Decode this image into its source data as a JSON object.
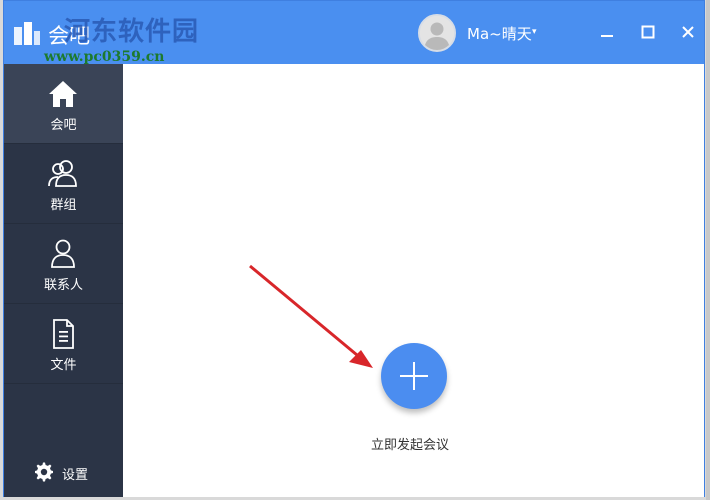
{
  "window": {
    "title": "会吧",
    "watermark": "河东软件园",
    "watermark_url": "www.pc0359.cn"
  },
  "user": {
    "name": "Ma~晴天",
    "caret": "▾"
  },
  "window_controls": {
    "minimize_icon": "minimize-icon",
    "maximize_icon": "maximize-icon",
    "close_icon": "close-icon"
  },
  "sidebar": {
    "items": [
      {
        "label": "会吧",
        "icon": "home-icon",
        "active": true
      },
      {
        "label": "群组",
        "icon": "group-icon",
        "active": false
      },
      {
        "label": "联系人",
        "icon": "contact-icon",
        "active": false
      },
      {
        "label": "文件",
        "icon": "file-icon",
        "active": false
      }
    ],
    "settings_label": "设置"
  },
  "main": {
    "start_meeting_label": "立即发起会议"
  },
  "colors": {
    "titlebar": "#4a8ff0",
    "sidebar": "#2b3446",
    "sidebar_active": "#3a4457",
    "start_button": "#4b8df0",
    "annotation_arrow": "#d8262a"
  }
}
